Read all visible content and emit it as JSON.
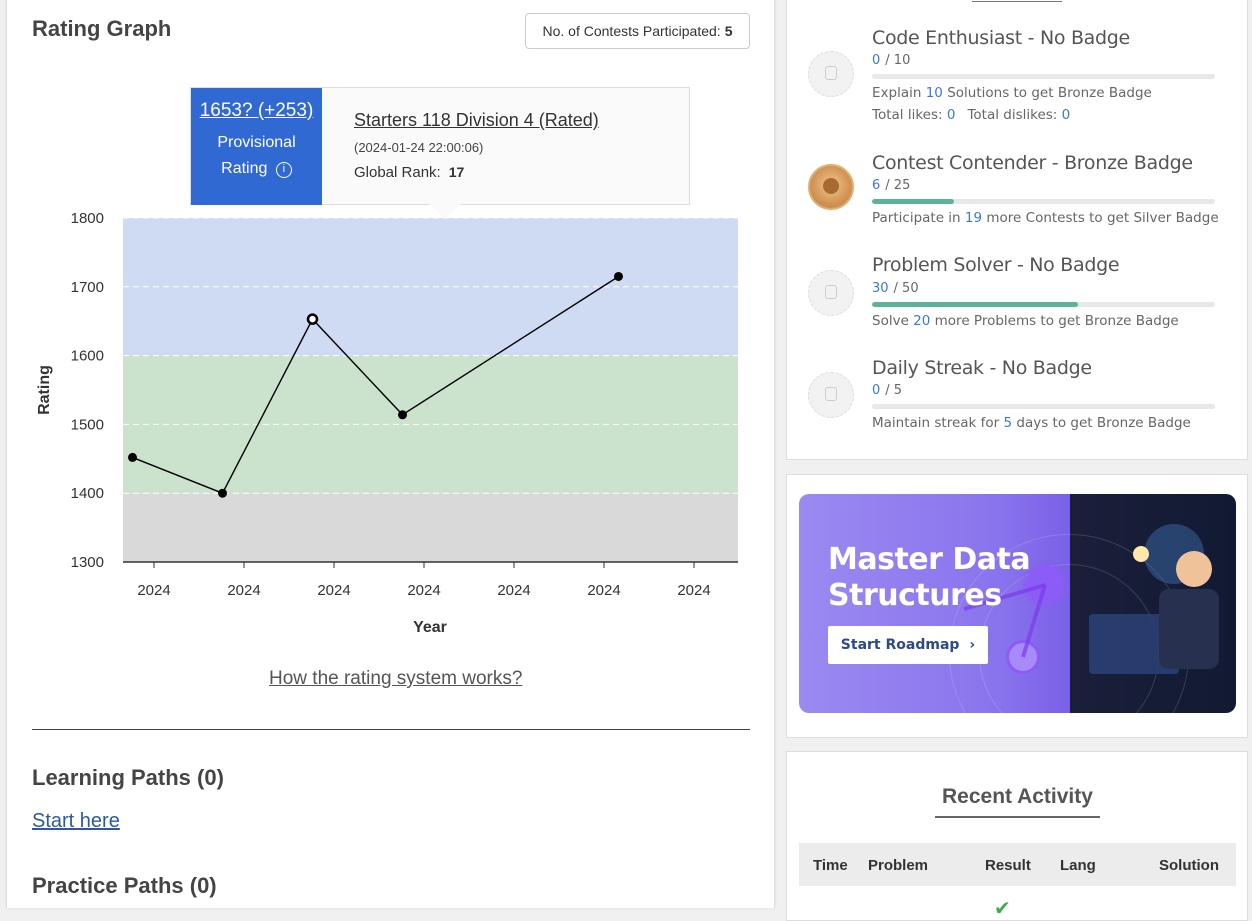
{
  "rating_graph": {
    "title": "Rating Graph",
    "contests_label": "No. of Contests Participated:",
    "contests_count": "5",
    "tooltip": {
      "rating": "1653? (+253)",
      "provisional_line1": "Provisional",
      "provisional_line2": "Rating",
      "info_icon": "info-icon",
      "contest_name": "Starters 118 Division 4 (Rated)",
      "contest_date": "(2024-01-24 22:00:06)",
      "rank_label": "Global Rank:",
      "rank_value": "17"
    },
    "how_link": "How the rating system works?"
  },
  "chart_data": {
    "type": "line",
    "xlabel": "Year",
    "ylabel": "Rating",
    "ylim": [
      1300,
      1800
    ],
    "yticks": [
      1300,
      1400,
      1500,
      1600,
      1700,
      1800
    ],
    "xtick_labels": [
      "2024",
      "2024",
      "2024",
      "2024",
      "2024",
      "2024",
      "2024"
    ],
    "bands": [
      {
        "from": 1300,
        "to": 1400,
        "color": "#d9d9d9"
      },
      {
        "from": 1400,
        "to": 1600,
        "color": "#cbe2cc"
      },
      {
        "from": 1600,
        "to": 1800,
        "color": "#cfdaf3"
      }
    ],
    "x": [
      0.05,
      1.05,
      2.05,
      3.05,
      5.45
    ],
    "y": [
      1452,
      1400,
      1653,
      1514,
      1715
    ],
    "highlight_index": 2,
    "grid": true
  },
  "paths": {
    "learning_title": "Learning Paths (0)",
    "start_here": "Start here",
    "practice_title": "Practice Paths (0)"
  },
  "badges": [
    {
      "name": "Code Enthusiast - No Badge",
      "current": "0",
      "total": "/ 10",
      "progress": 0.0,
      "status": "none",
      "icon": "lock-icon",
      "desc_pre": "Explain ",
      "desc_num": "10",
      "desc_post": " Solutions to get Bronze Badge",
      "likes_label": "Total likes: ",
      "likes": "0",
      "dislikes_label": "Total dislikes: ",
      "dislikes": "0"
    },
    {
      "name": "Contest Contender - Bronze Badge",
      "current": "6",
      "total": "/ 25",
      "progress": 0.24,
      "status": "bronze",
      "icon": "trophy-icon",
      "desc_pre": "Participate in ",
      "desc_num": "19",
      "desc_post": " more Contests to get Silver Badge"
    },
    {
      "name": "Problem Solver - No Badge",
      "current": "30",
      "total": "/ 50",
      "progress": 0.6,
      "status": "none",
      "icon": "lock-icon",
      "desc_pre": "Solve ",
      "desc_num": "20",
      "desc_post": " more Problems to get Bronze Badge"
    },
    {
      "name": "Daily Streak - No Badge",
      "current": "0",
      "total": "/ 5",
      "progress": 0.0,
      "status": "none",
      "icon": "lock-icon",
      "desc_pre": "Maintain streak for ",
      "desc_num": "5",
      "desc_post": " days to get Bronze Badge"
    }
  ],
  "banner": {
    "title_line1": "Master Data",
    "title_line2": "Structures",
    "button": "Start Roadmap",
    "button_icon": "chevron-right-icon"
  },
  "recent_activity": {
    "title": "Recent Activity",
    "columns": [
      "Time",
      "Problem",
      "Result",
      "Lang",
      "Solution"
    ],
    "first_result_icon": "check-icon"
  },
  "colors": {
    "accent_blue": "#2f69d1",
    "progress_green": "#5db39a",
    "link_blue": "#3a78d8"
  }
}
